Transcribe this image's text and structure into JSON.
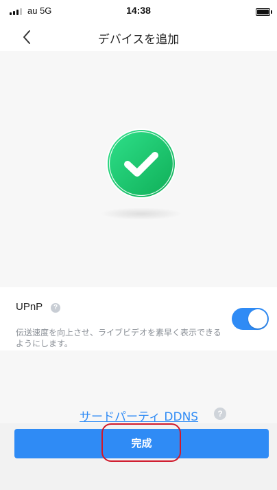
{
  "status_bar": {
    "carrier": "au  5G",
    "time": "14:38"
  },
  "nav": {
    "title": "デバイスを追加",
    "back_icon": "chevron-left-icon"
  },
  "hero": {
    "icon": "check-circle-icon",
    "accent_color": "#1fc46b"
  },
  "upnp": {
    "title": "UPnP",
    "help_glyph": "?",
    "description": "伝送速度を向上させ、ライブビデオを素早く表示できるようにします。",
    "enabled": true
  },
  "ddns": {
    "link_text": "サードパーティ DDNS",
    "help_glyph": "?"
  },
  "footer": {
    "done_label": "完成"
  },
  "colors": {
    "primary": "#2f8bf5",
    "highlight": "#d0192b"
  }
}
